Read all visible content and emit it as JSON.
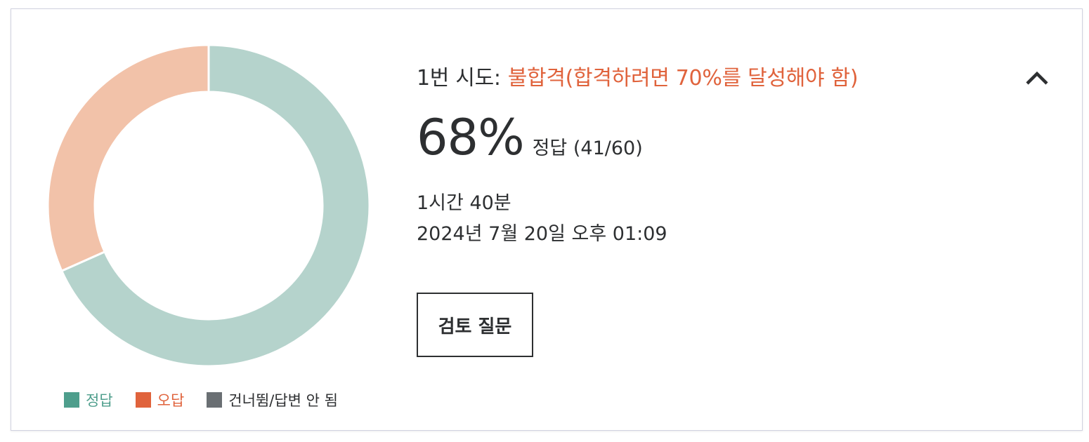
{
  "colors": {
    "correct_fill": "#b5d3cc",
    "incorrect_fill": "#f2c2a9",
    "correct_swatch": "#4e9e8c",
    "incorrect_swatch": "#e0633c",
    "skipped_swatch": "#6a6f73",
    "fail_text": "#e0633c",
    "text": "#2d2f31"
  },
  "chart_data": {
    "type": "pie",
    "style": "donut",
    "slices": [
      {
        "label": "정답",
        "value": 41
      },
      {
        "label": "오답",
        "value": 19
      },
      {
        "label": "건너뜀/답변 안 됨",
        "value": 0
      }
    ],
    "total": 60
  },
  "legend": {
    "correct": "정답",
    "incorrect": "오답",
    "skipped": "건너뜀/답변 안 됨"
  },
  "attempt": {
    "label": "1번 시도:",
    "status": "불합격(합격하려면 70%를 달성해야 함)"
  },
  "score": {
    "percent": "68%",
    "detail": "정답 (41/60)"
  },
  "duration": "1시간 40분",
  "date": "2024년 7월 20일 오후 01:09",
  "review_button": "검토 질문",
  "collapse_icon": "chevron-up-icon"
}
